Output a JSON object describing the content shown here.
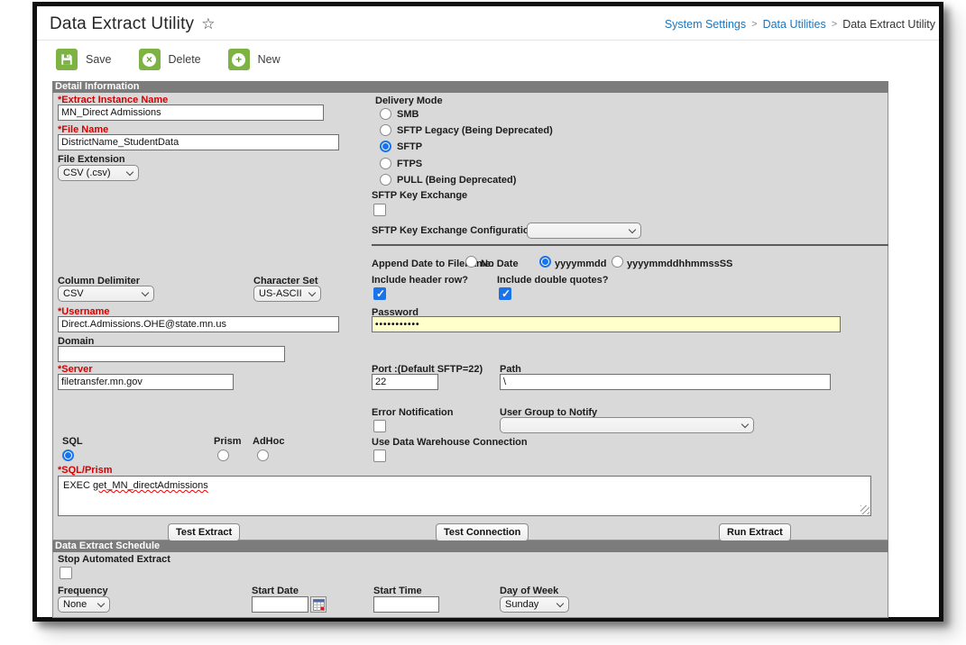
{
  "colors": {
    "toolbar_green": "#7db343",
    "link_blue": "#1b75bc",
    "selection_blue": "#1a73e8",
    "required_red": "#d60000",
    "section_header_bg": "#7c7c7c",
    "section_body_bg": "#d9d9d9",
    "password_field_bg": "#ffffcc"
  },
  "page": {
    "title": "Data Extract Utility",
    "favorite_icon": "☆",
    "breadcrumb": {
      "separator": ">",
      "items": [
        {
          "label": "System Settings"
        },
        {
          "label": "Data Utilities"
        },
        {
          "label": "Data Extract Utility"
        }
      ]
    }
  },
  "toolbar": {
    "save": "Save",
    "delete": "Delete",
    "new": "New",
    "delete_glyph": "×",
    "new_glyph": "+"
  },
  "detail": {
    "header": "Detail Information",
    "extract_instance_name": {
      "label": "*Extract Instance Name",
      "value": "MN_Direct Admissions"
    },
    "file_name": {
      "label": "*File Name",
      "value": "DistrictName_StudentData"
    },
    "file_extension": {
      "label": "File Extension",
      "value": "CSV (.csv)"
    },
    "delivery_mode": {
      "label": "Delivery Mode",
      "options": [
        {
          "label": "SMB",
          "selected": false
        },
        {
          "label": "SFTP Legacy (Being Deprecated)",
          "selected": false
        },
        {
          "label": "SFTP",
          "selected": true
        },
        {
          "label": "FTPS",
          "selected": false
        },
        {
          "label": "PULL (Being Deprecated)",
          "selected": false
        }
      ]
    },
    "sftp_key_exchange": {
      "label": "SFTP Key Exchange",
      "checked": false
    },
    "sftp_key_exchange_configuration": {
      "label": "SFTP Key Exchange Configuration",
      "value": ""
    },
    "column_delimiter": {
      "label": "Column Delimiter",
      "value": "CSV"
    },
    "character_set": {
      "label": "Character Set",
      "value": "US-ASCII"
    },
    "append_date": {
      "label": "Append Date to Filename:",
      "options": [
        {
          "label": "No Date",
          "selected": false
        },
        {
          "label": "yyyymmdd",
          "selected": true
        },
        {
          "label": "yyyymmddhhmmssSS",
          "selected": false
        }
      ]
    },
    "include_header_row": {
      "label": "Include header row?",
      "checked": true
    },
    "include_double_quotes": {
      "label": "Include double quotes?",
      "checked": true
    },
    "username": {
      "label": "*Username",
      "value": "Direct.Admissions.OHE@state.mn.us"
    },
    "password": {
      "label": "Password",
      "masked_value": "•••••••••••"
    },
    "domain": {
      "label": "Domain",
      "value": ""
    },
    "server": {
      "label": "*Server",
      "value": "filetransfer.mn.gov"
    },
    "port": {
      "label": "Port :(Default SFTP=22)",
      "value": "22"
    },
    "path": {
      "label": "Path",
      "value": "\\"
    },
    "error_notification": {
      "label": "Error Notification",
      "checked": false
    },
    "user_group_to_notify": {
      "label": "User Group to Notify",
      "value": ""
    },
    "sql_source": {
      "options": [
        {
          "label": "SQL",
          "selected": true
        },
        {
          "label": "Prism",
          "selected": false
        },
        {
          "label": "AdHoc",
          "selected": false
        }
      ]
    },
    "use_data_warehouse": {
      "label": "Use Data Warehouse Connection",
      "checked": false
    },
    "sql_prism": {
      "label": "*SQL/Prism",
      "value_prefix": "EXEC ",
      "value_flagged": "get_MN_directAdmissions"
    },
    "buttons": {
      "test_extract": "Test Extract",
      "test_connection": "Test Connection",
      "run_extract": "Run Extract"
    }
  },
  "schedule": {
    "header": "Data Extract Schedule",
    "stop_automated_extract": {
      "label": "Stop Automated Extract",
      "checked": false
    },
    "frequency": {
      "label": "Frequency",
      "value": "None"
    },
    "start_date": {
      "label": "Start Date",
      "value": ""
    },
    "start_time": {
      "label": "Start Time",
      "value": ""
    },
    "day_of_week": {
      "label": "Day of Week",
      "value": "Sunday"
    }
  }
}
